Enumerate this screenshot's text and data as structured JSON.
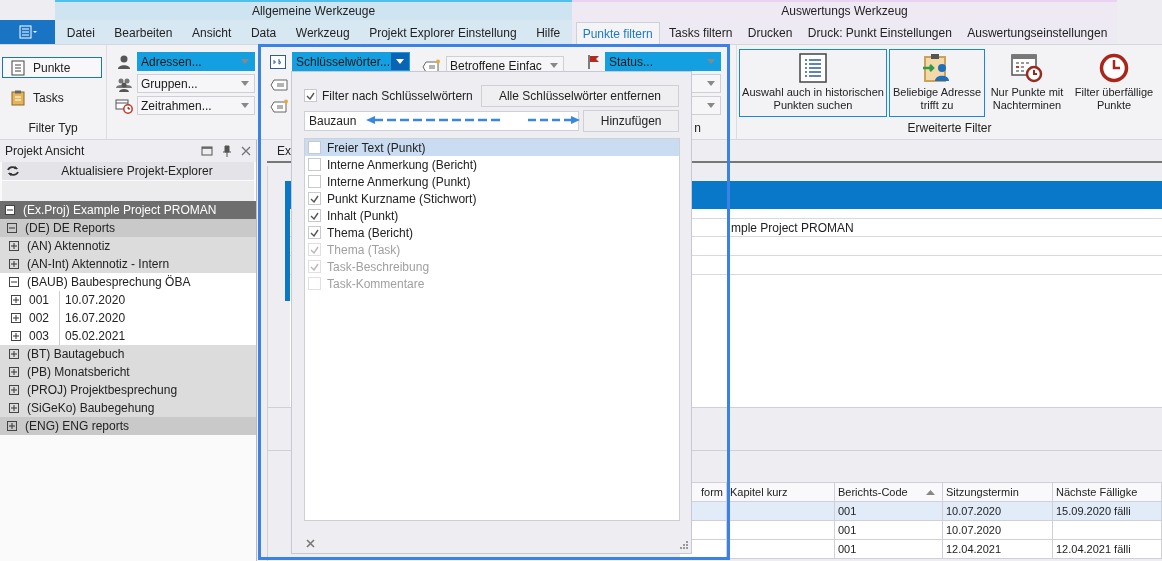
{
  "context_groups": [
    {
      "kind": "general",
      "label": "Allgemeine Werkzeuge",
      "tabs": [
        {
          "label": "Datei",
          "selected": false
        },
        {
          "label": "Bearbeiten",
          "selected": false
        },
        {
          "label": "Ansicht",
          "selected": false
        },
        {
          "label": "Data",
          "selected": false
        },
        {
          "label": "Werkzeug",
          "selected": false
        },
        {
          "label": "Projekt Explorer Einstellung",
          "selected": false
        },
        {
          "label": "Hilfe",
          "selected": false
        }
      ]
    },
    {
      "kind": "analysis",
      "label": "Auswertungs Werkzeug",
      "tabs": [
        {
          "label": "Punkte filtern",
          "selected": true
        },
        {
          "label": "Tasks filtern",
          "selected": false
        },
        {
          "label": "Drucken",
          "selected": false
        },
        {
          "label": "Druck: Punkt Einstellungen",
          "selected": false
        },
        {
          "label": "Auswertungseinstellungen",
          "selected": false
        }
      ]
    }
  ],
  "ribbon": {
    "filter_type": {
      "label": "Filter Typ",
      "buttons": [
        {
          "label": "Punkte",
          "selected": true
        },
        {
          "label": "Tasks",
          "selected": false
        }
      ]
    },
    "address_combos": [
      {
        "label": "Adressen...",
        "highlighted": true
      },
      {
        "label": "Gruppen...",
        "highlighted": false
      },
      {
        "label": "Zeitrahmen...",
        "highlighted": false
      }
    ],
    "keyword_combo": {
      "label": "Schlüsselwörter...",
      "highlighted": true,
      "open": true
    },
    "affected_combo": {
      "label": "Betroffene Einfac",
      "highlighted": false
    },
    "status_combos": [
      {
        "label": "Status...",
        "highlighted": true
      },
      {
        "highlighted": false
      },
      {
        "highlighted": false
      }
    ],
    "group_label_fragment": "n",
    "advanced": {
      "label": "Erweiterte Filter",
      "buttons": [
        {
          "label": "Auswahl auch in historischen Punkten suchen",
          "selected": true
        },
        {
          "label": "Beliebige Adresse trifft zu",
          "selected": true
        },
        {
          "label": "Nur Punkte mit Nachterminen",
          "selected": false
        },
        {
          "label": "Filter überfällige Punkte",
          "selected": false
        }
      ]
    }
  },
  "project_panel": {
    "title": "Projekt Ansicht",
    "refresh_button": "Aktualisiere Projekt-Explorer",
    "tree": [
      {
        "label": "(Ex.Proj) Example Project PROMAN",
        "expanded": true,
        "selected": false,
        "children": [
          {
            "label": "(DE) DE Reports",
            "expanded": true,
            "selected": false,
            "children": [
              {
                "label": "(AN) Aktennotiz",
                "expanded": false,
                "selected": false
              },
              {
                "label": "(AN-Int) Aktennotiz - Intern",
                "expanded": false,
                "selected": false
              },
              {
                "label": "(BAUB) Baubesprechung ÖBA",
                "expanded": true,
                "selected": true,
                "children": [
                  {
                    "code": "001",
                    "date": "10.07.2020",
                    "expanded": false,
                    "selected": true
                  },
                  {
                    "code": "002",
                    "date": "16.07.2020",
                    "expanded": false,
                    "selected": true
                  },
                  {
                    "code": "003",
                    "date": "05.02.2021",
                    "expanded": false,
                    "selected": true
                  }
                ]
              },
              {
                "label": "(BT) Bautagebuch",
                "expanded": false,
                "selected": false
              },
              {
                "label": "(PB) Monatsbericht",
                "expanded": false,
                "selected": false
              },
              {
                "label": "(PROJ) Projektbesprechung",
                "expanded": false,
                "selected": false
              },
              {
                "label": "(SiGeKo) Baubegehung",
                "expanded": false,
                "selected": false
              }
            ]
          },
          {
            "label": "(ENG) ENG reports",
            "expanded": false,
            "selected": false
          }
        ]
      }
    ]
  },
  "content": {
    "tab": "Ex",
    "project_row": "mple Project PROMAN",
    "table": {
      "columns": [
        {
          "label": "form",
          "sorted": false
        },
        {
          "label": "Kapitel kurz",
          "sorted": false
        },
        {
          "label": "Berichts-Code",
          "sorted": true
        },
        {
          "label": "Sitzungstermin",
          "sorted": false
        },
        {
          "label": "Nächste Fälligke",
          "sorted": false
        }
      ],
      "rows": [
        {
          "selected": true,
          "cells": [
            null,
            null,
            "001",
            "10.07.2020",
            "15.09.2020 fälli"
          ]
        },
        {
          "selected": false,
          "cells": [
            null,
            null,
            "001",
            "10.07.2020",
            null
          ]
        },
        {
          "selected": false,
          "cells": [
            null,
            null,
            "001",
            "12.04.2021",
            "12.04.2021 fälli"
          ]
        }
      ]
    }
  },
  "popup": {
    "filter_checkbox": {
      "label": "Filter nach Schlüsselwörtern",
      "checked": true
    },
    "remove_all_button": "Alle Schlüsselwörter entfernen",
    "keyword_input": {
      "value": "Bauzaun"
    },
    "add_button": "Hinzufügen",
    "fields": [
      {
        "label": "Freier Text (Punkt)",
        "checked": false,
        "disabled": false,
        "selected": true
      },
      {
        "label": "Interne Anmerkung (Bericht)",
        "checked": false,
        "disabled": false,
        "selected": false
      },
      {
        "label": "Interne Anmerkung (Punkt)",
        "checked": false,
        "disabled": false,
        "selected": false
      },
      {
        "label": "Punkt Kurzname (Stichwort)",
        "checked": true,
        "disabled": false,
        "selected": false
      },
      {
        "label": "Inhalt (Punkt)",
        "checked": true,
        "disabled": false,
        "selected": false
      },
      {
        "label": "Thema (Bericht)",
        "checked": true,
        "disabled": false,
        "selected": false
      },
      {
        "label": "Thema (Task)",
        "checked": true,
        "disabled": true,
        "selected": false
      },
      {
        "label": "Task-Beschreibung",
        "checked": true,
        "disabled": true,
        "selected": false
      },
      {
        "label": "Task-Kommentare",
        "checked": false,
        "disabled": true,
        "selected": false
      }
    ]
  }
}
